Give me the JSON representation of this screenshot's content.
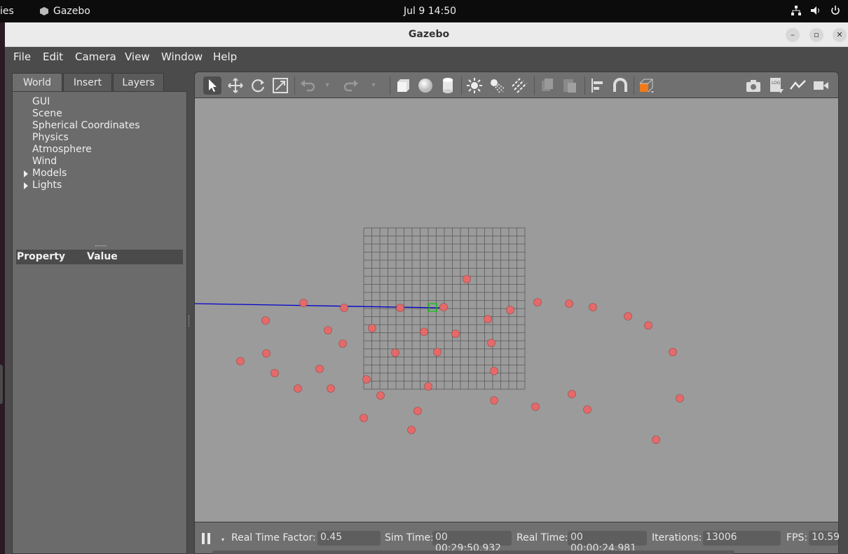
{
  "topbar": {
    "activities": "ies",
    "app_name": "Gazebo",
    "clock": "Jul 9  14:50"
  },
  "window": {
    "title": "Gazebo"
  },
  "menu": [
    "File",
    "Edit",
    "Camera",
    "View",
    "Window",
    "Help"
  ],
  "tabs": [
    "World",
    "Insert",
    "Layers"
  ],
  "tree": {
    "items": [
      "GUI",
      "Scene",
      "Spherical Coordinates",
      "Physics",
      "Atmosphere",
      "Wind"
    ],
    "expandable": [
      "Models",
      "Lights"
    ]
  },
  "properties": {
    "col_property": "Property",
    "col_value": "Value"
  },
  "toolbar_icons": [
    "select-icon",
    "translate-icon",
    "rotate-icon",
    "scale-icon",
    "undo-icon",
    "redo-icon",
    "box-icon",
    "sphere-icon",
    "cylinder-icon",
    "point-light-icon",
    "spot-light-icon",
    "directional-light-icon",
    "copy-icon",
    "paste-icon",
    "align-icon",
    "snap-icon",
    "view-angle-icon",
    "screenshot-icon",
    "log-icon",
    "plot-icon",
    "video-icon"
  ],
  "status": {
    "rtf_label": "Real Time Factor:",
    "rtf_value": "0.45",
    "sim_label": "Sim Time:",
    "sim_value": "00 00:29:50.932",
    "real_label": "Real Time:",
    "real_value": "00 00:00:24.981",
    "iter_label": "Iterations:",
    "iter_value": "13006",
    "fps_label": "FPS:",
    "fps_value": "10.59"
  },
  "colors": {
    "viewport_bg": "#9b9b9b",
    "marker": "#e46a6a",
    "axis_line": "#0000cc",
    "selection": "#00cc00"
  }
}
